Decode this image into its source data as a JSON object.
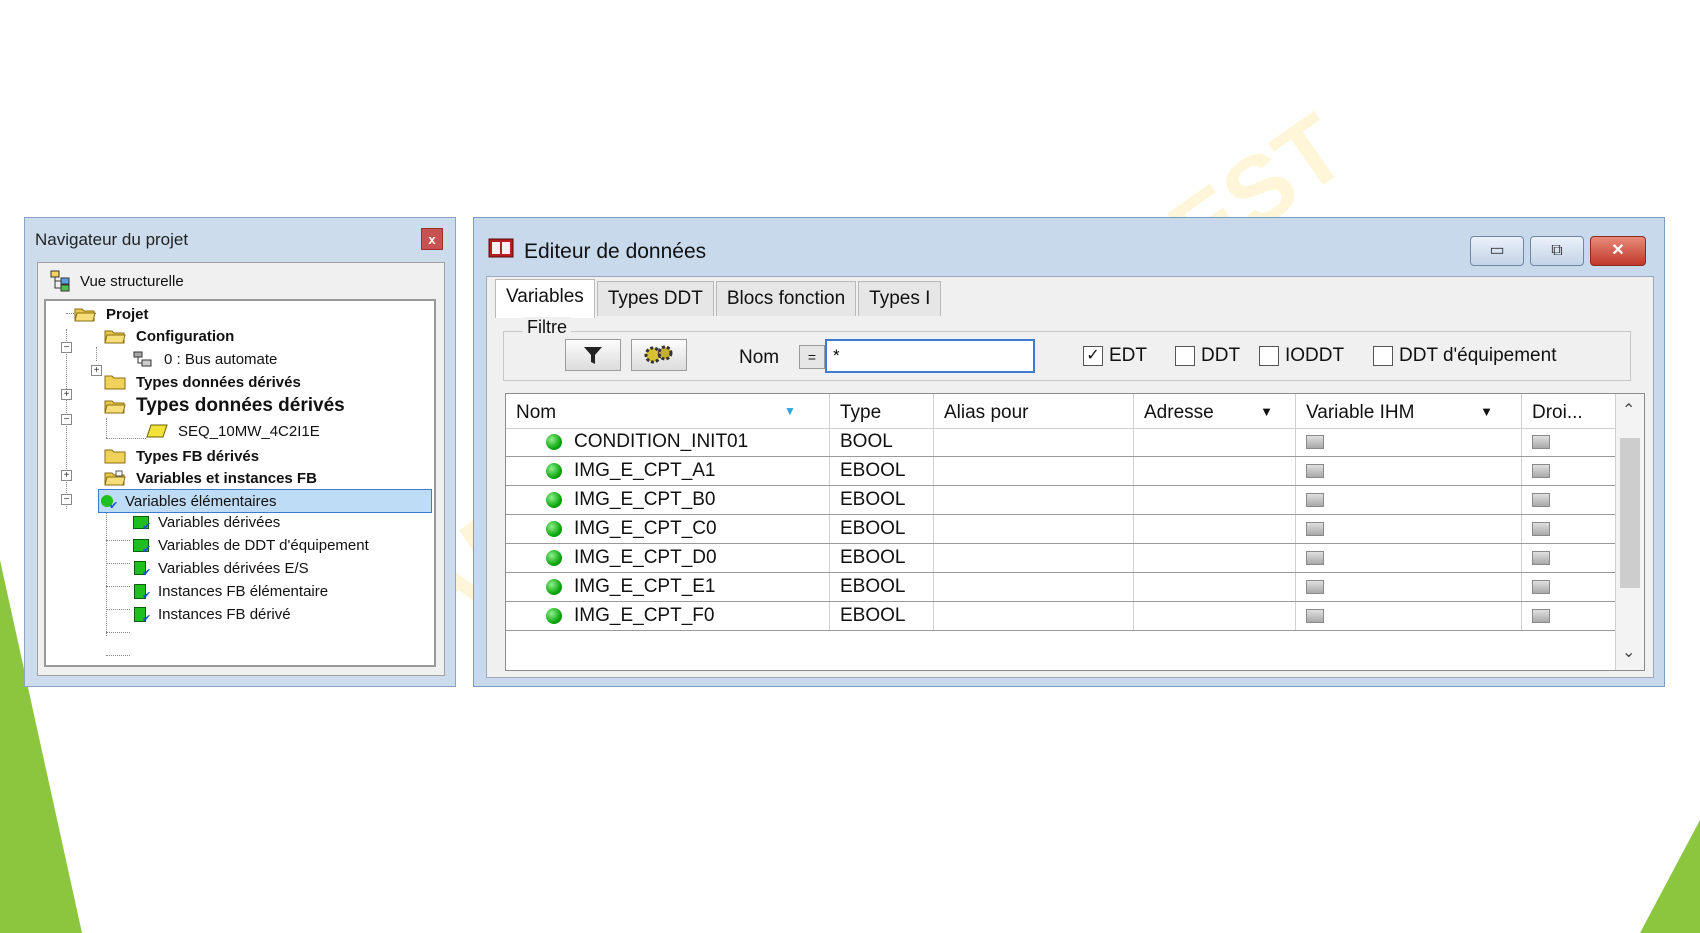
{
  "navigator": {
    "title": "Navigateur du projet",
    "close_label": "x",
    "view_label": "Vue structurelle",
    "tree": {
      "projet": "Projet",
      "configuration": "Configuration",
      "bus": "0 : Bus automate",
      "types_derives_1": "Types données dérivés",
      "types_derives_2": "Types données dérivés",
      "seq": "SEQ_10MW_4C2I1E",
      "types_fb": "Types FB dérivés",
      "variables_instances": "Variables et instances FB",
      "var_elem": "Variables élémentaires",
      "var_derivees": "Variables dérivées",
      "var_ddt": "Variables de DDT d'équipement",
      "var_derivees_es": "Variables dérivées E/S",
      "inst_fb_elem": "Instances FB élémentaire",
      "inst_fb_derive": "Instances FB dérivé"
    }
  },
  "editor": {
    "title": "Editeur de données",
    "tabs": [
      "Variables",
      "Types DDT",
      "Blocs fonction",
      "Types I"
    ],
    "filter_label": "Filtre",
    "nom_label": "Nom",
    "eq_label": "=",
    "nom_value": "*",
    "checks": [
      {
        "label": "EDT",
        "checked": "✓"
      },
      {
        "label": "DDT",
        "checked": ""
      },
      {
        "label": "IODDT",
        "checked": ""
      },
      {
        "label": "DDT d'équipement",
        "checked": ""
      }
    ],
    "columns": [
      "Nom",
      "Type",
      "Alias pour",
      "Adresse",
      "Variable IHM",
      "Droi..."
    ],
    "rows": [
      {
        "name": "CONDITION_INIT01",
        "type": "BOOL"
      },
      {
        "name": "IMG_E_CPT_A1",
        "type": "EBOOL"
      },
      {
        "name": "IMG_E_CPT_B0",
        "type": "EBOOL"
      },
      {
        "name": "IMG_E_CPT_C0",
        "type": "EBOOL"
      },
      {
        "name": "IMG_E_CPT_D0",
        "type": "EBOOL"
      },
      {
        "name": "IMG_E_CPT_E1",
        "type": "EBOOL"
      },
      {
        "name": "IMG_E_CPT_F0",
        "type": "EBOOL"
      }
    ]
  },
  "colors": {
    "accent_green": "#8cc63f",
    "selection": "#bfdcf7",
    "close_red": "#c0392b"
  }
}
